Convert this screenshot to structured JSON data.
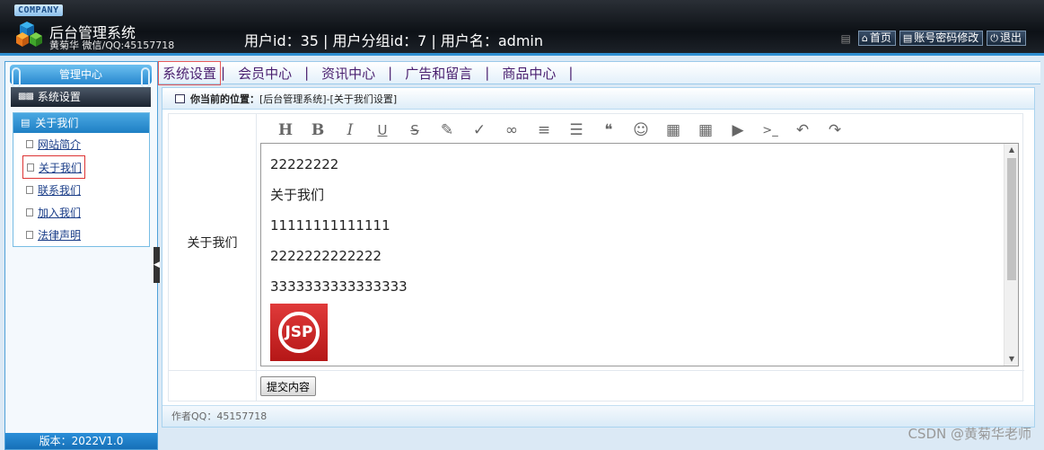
{
  "header": {
    "company": "COMPANY",
    "title": "后台管理系统",
    "subtitle": "黄菊华 微信/QQ:45157718",
    "userinfo": "用户id：35 | 用户分组id：7 | 用户名：admin",
    "links": [
      {
        "icon": "home-icon",
        "label": "首页"
      },
      {
        "icon": "list-icon",
        "label": "账号密码修改"
      },
      {
        "icon": "power-icon",
        "label": "退出"
      }
    ]
  },
  "sidebar": {
    "header": "管理中心",
    "section": "系统设置",
    "group": "关于我们",
    "items": [
      {
        "label": "网站简介"
      },
      {
        "label": "关于我们"
      },
      {
        "label": "联系我们"
      },
      {
        "label": "加入我们"
      },
      {
        "label": "法律声明"
      }
    ],
    "footer": "版本：2022V1.0"
  },
  "nav": {
    "items": [
      "系统设置",
      "会员中心",
      "资讯中心",
      "广告和留言",
      "商品中心"
    ],
    "separator": "|"
  },
  "breadcrumb": {
    "label": "你当前的位置：",
    "path": "[后台管理系统]-[关于我们设置]"
  },
  "form": {
    "field_label": "关于我们",
    "content": [
      "22222222",
      "关于我们",
      "11111111111111",
      "2222222222222",
      "3333333333333333"
    ],
    "image_text": "JSP",
    "submit_label": "提交内容"
  },
  "footer": {
    "text": "作者QQ：45157718"
  },
  "watermark": "CSDN @黄菊华老师",
  "colors": {
    "accent": "#2f8fd1",
    "nav_text": "#4a1f6f",
    "active_border": "#e65a5a"
  }
}
